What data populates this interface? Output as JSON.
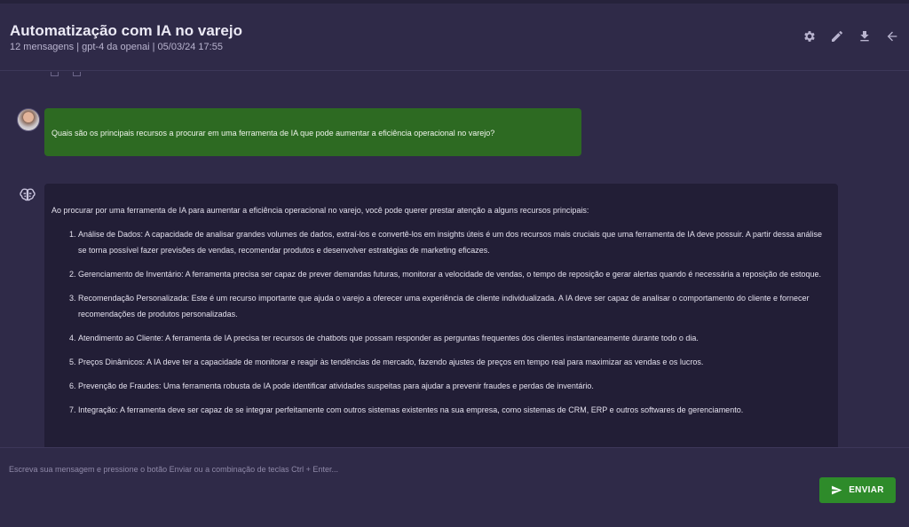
{
  "header": {
    "title": "Automatização com IA no varejo",
    "subtitle": "12 mensagens | gpt-4 da openai | 05/03/24 17:55",
    "icons": [
      "gear-icon",
      "edit-icon",
      "download-icon",
      "back-arrow-icon"
    ]
  },
  "messages": {
    "user": {
      "text": "Quais são os principais recursos a procurar em uma ferramenta de IA que pode aumentar a eficiência operacional no varejo?"
    },
    "assistant": {
      "intro": "Ao procurar por uma ferramenta de IA para aumentar a eficiência operacional no varejo, você pode querer prestar atenção a alguns recursos principais:",
      "items": [
        "Análise de Dados: A capacidade de analisar grandes volumes de dados, extraí-los e convertê-los em insights úteis é um dos recursos mais cruciais que uma ferramenta de IA deve possuir. A partir dessa análise se torna possível fazer previsões de vendas, recomendar produtos e desenvolver estratégias de marketing eficazes.",
        "Gerenciamento de Inventário: A ferramenta precisa ser capaz de prever demandas futuras, monitorar a velocidade de vendas, o tempo de reposição e gerar alertas quando é necessária a reposição de estoque.",
        "Recomendação Personalizada: Este é um recurso importante que ajuda o varejo a oferecer uma experiência de cliente individualizada. A IA deve ser capaz de analisar o comportamento do cliente e fornecer recomendações de produtos personalizadas.",
        "Atendimento ao Cliente: A ferramenta de IA precisa ter recursos de chatbots que possam responder as perguntas frequentes dos clientes instantaneamente durante todo o dia.",
        "Preços Dinâmicos: A IA deve ter a capacidade de monitorar e reagir às tendências de mercado, fazendo ajustes de preços em tempo real para maximizar as vendas e os lucros.",
        "Prevenção de Fraudes: Uma ferramenta robusta de IA pode identificar atividades suspeitas para ajudar a prevenir fraudes e perdas de inventário.",
        "Integração: A ferramenta deve ser capaz de se integrar perfeitamente com outros sistemas existentes na sua empresa, como sistemas de CRM, ERP e outros softwares de gerenciamento."
      ]
    }
  },
  "composer": {
    "placeholder": "Escreva sua mensagem e pressione o botão Enviar ou a combinação de teclas Ctrl + Enter...",
    "value": "",
    "send_label": "ENVIAR"
  },
  "colors": {
    "background": "#2f2a48",
    "user_bubble": "#2d6a22",
    "assistant_bubble": "#221e36",
    "send_button": "#2e8b2a"
  }
}
